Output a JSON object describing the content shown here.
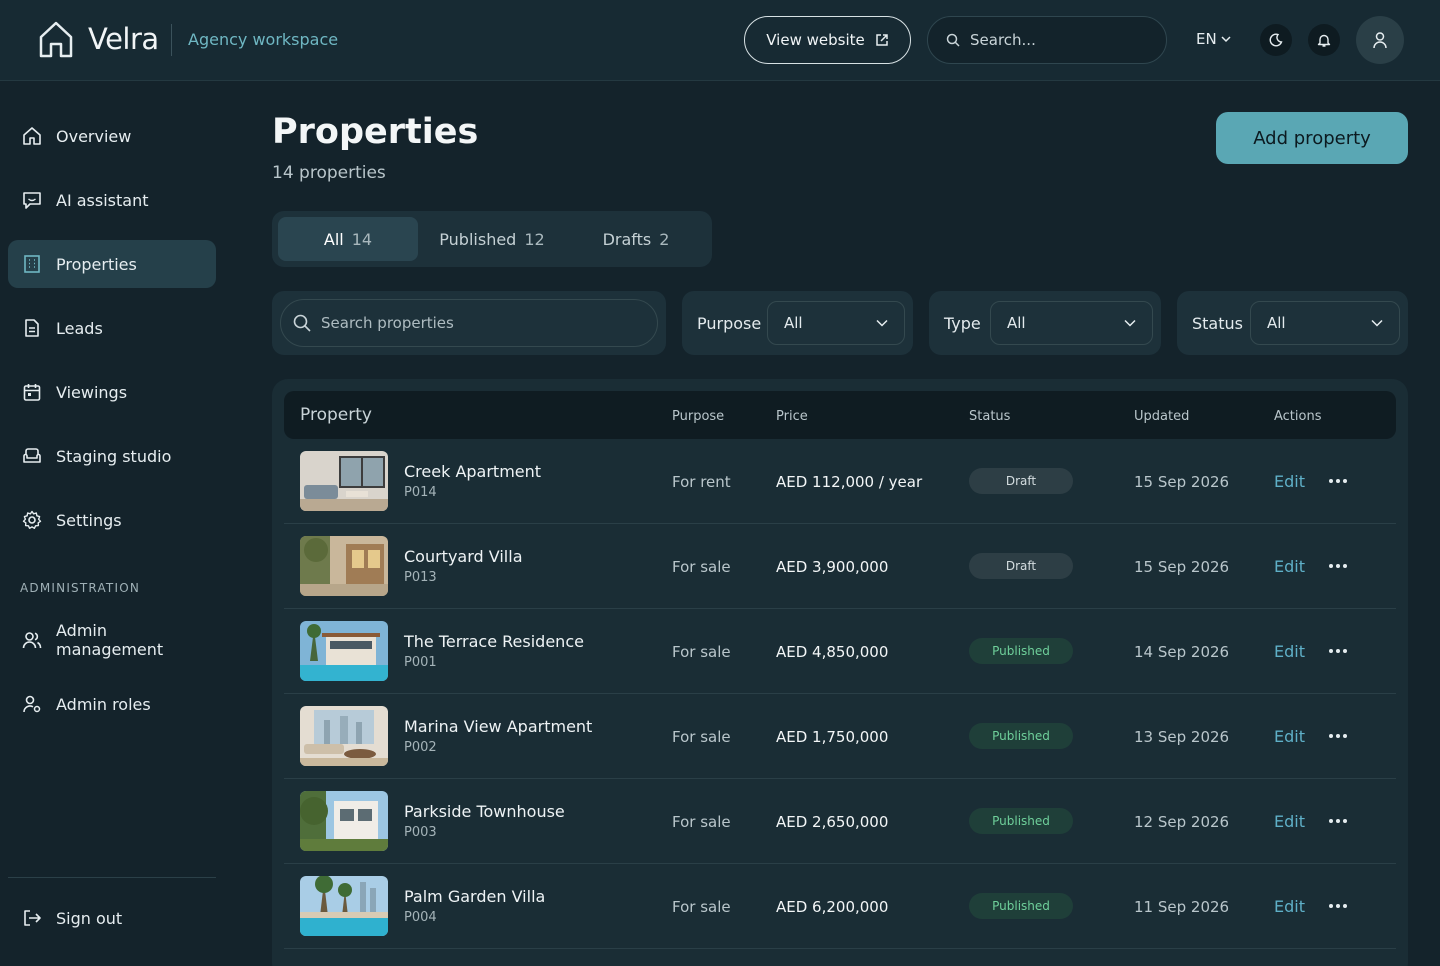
{
  "header": {
    "brand": "Velra",
    "workspace": "Agency workspace",
    "view_website": "View website",
    "search_placeholder": "Search...",
    "language": "EN"
  },
  "sidebar": {
    "items": [
      {
        "label": "Overview",
        "icon": "home-icon"
      },
      {
        "label": "AI assistant",
        "icon": "chat-icon"
      },
      {
        "label": "Properties",
        "icon": "building-icon",
        "active": true
      },
      {
        "label": "Leads",
        "icon": "document-icon"
      },
      {
        "label": "Viewings",
        "icon": "calendar-icon"
      },
      {
        "label": "Staging studio",
        "icon": "sofa-icon"
      },
      {
        "label": "Settings",
        "icon": "gear-icon"
      }
    ],
    "admin_section": "ADMINISTRATION",
    "admin_items": [
      {
        "label": "Admin management",
        "icon": "users-icon"
      },
      {
        "label": "Admin roles",
        "icon": "user-key-icon"
      }
    ],
    "sign_out": "Sign out"
  },
  "main": {
    "title": "Properties",
    "subtitle": "14 properties",
    "add_button": "Add property",
    "tabs": [
      {
        "label": "All",
        "count": "14",
        "active": true
      },
      {
        "label": "Published",
        "count": "12"
      },
      {
        "label": "Drafts",
        "count": "2"
      }
    ],
    "filters": {
      "search_placeholder": "Search properties",
      "purpose_label": "Purpose",
      "purpose_value": "All",
      "type_label": "Type",
      "type_value": "All",
      "status_label": "Status",
      "status_value": "All"
    },
    "table": {
      "columns": [
        "Property",
        "Purpose",
        "Price",
        "Status",
        "Updated",
        "Actions"
      ],
      "rows": [
        {
          "name": "Creek Apartment",
          "id": "P014",
          "purpose": "For rent",
          "price": "AED 112,000 / year",
          "status": "Draft",
          "updated": "15 Sep 2026",
          "action": "Edit"
        },
        {
          "name": "Courtyard Villa",
          "id": "P013",
          "purpose": "For sale",
          "price": "AED 3,900,000",
          "status": "Draft",
          "updated": "15 Sep 2026",
          "action": "Edit"
        },
        {
          "name": "The Terrace Residence",
          "id": "P001",
          "purpose": "For sale",
          "price": "AED 4,850,000",
          "status": "Published",
          "updated": "14 Sep 2026",
          "action": "Edit"
        },
        {
          "name": "Marina View Apartment",
          "id": "P002",
          "purpose": "For sale",
          "price": "AED 1,750,000",
          "status": "Published",
          "updated": "13 Sep 2026",
          "action": "Edit"
        },
        {
          "name": "Parkside Townhouse",
          "id": "P003",
          "purpose": "For sale",
          "price": "AED 2,650,000",
          "status": "Published",
          "updated": "12 Sep 2026",
          "action": "Edit"
        },
        {
          "name": "Palm Garden Villa",
          "id": "P004",
          "purpose": "For sale",
          "price": "AED 6,200,000",
          "status": "Published",
          "updated": "11 Sep 2026",
          "action": "Edit"
        }
      ]
    }
  },
  "colors": {
    "accent": "#5aa7b4",
    "published": "#6fd09b",
    "link": "#5fb0c8"
  }
}
